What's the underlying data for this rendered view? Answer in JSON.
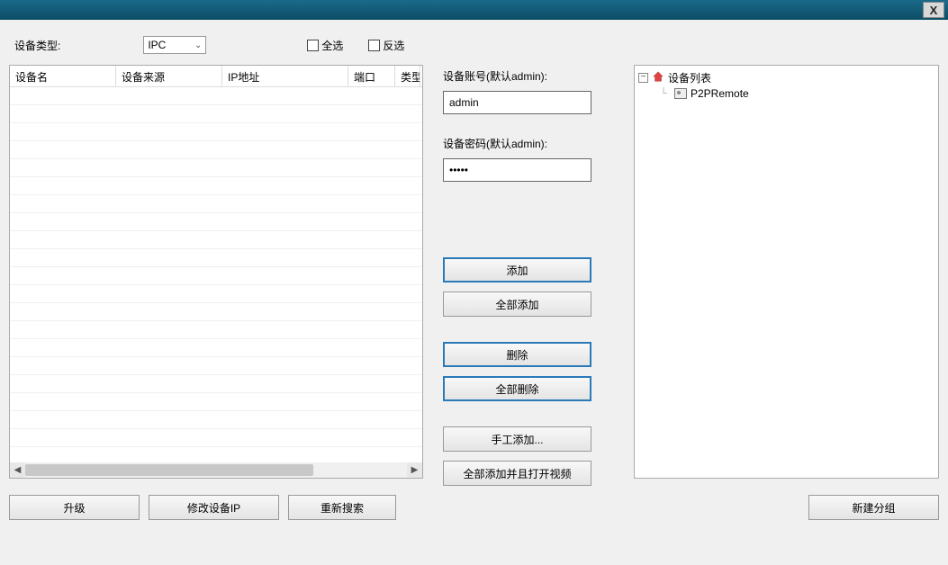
{
  "titlebar": {
    "close": "X"
  },
  "top": {
    "device_type_label": "设备类型:",
    "device_type_value": "IPC",
    "select_all": "全选",
    "invert_select": "反选"
  },
  "table": {
    "headers": [
      "设备名",
      "设备来源",
      "IP地址",
      "端口",
      "类型"
    ]
  },
  "left_buttons": {
    "upgrade": "升级",
    "modify_ip": "修改设备IP",
    "research": "重新搜索"
  },
  "mid": {
    "account_label": "设备账号(默认admin):",
    "account_value": "admin",
    "password_label": "设备密码(默认admin):",
    "password_value": "•••••",
    "add": "添加",
    "add_all": "全部添加",
    "delete": "删除",
    "delete_all": "全部删除",
    "manual_add": "手工添加...",
    "add_all_open": "全部添加并且打开视频"
  },
  "tree": {
    "root": "设备列表",
    "child1": "P2PRemote"
  },
  "right_buttons": {
    "new_group": "新建分组"
  }
}
